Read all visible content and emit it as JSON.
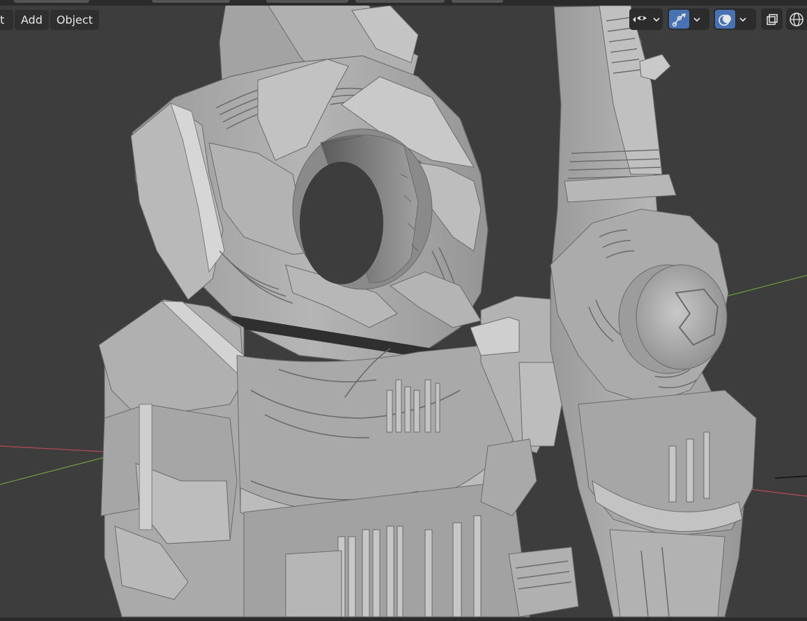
{
  "menu": {
    "items": [
      {
        "label": "t",
        "name": "menu-object-mode-cut"
      },
      {
        "label": "Add",
        "name": "menu-add"
      },
      {
        "label": "Object",
        "name": "menu-object"
      }
    ]
  },
  "toolbar": {
    "icons": [
      {
        "name": "visibility-eye-icon"
      },
      {
        "name": "gizmo-icon"
      },
      {
        "name": "overlays-icon"
      },
      {
        "name": "xray-toggle-icon"
      },
      {
        "name": "wireframe-shading-icon"
      }
    ]
  },
  "colors": {
    "viewport_bg": "#3d3d3d",
    "model_gray": "#a8a8a8",
    "model_light": "#c9c9c9",
    "model_dark": "#6d6d6d",
    "axis_x": "#b84b54",
    "axis_y": "#6e9a3a",
    "active_button": "#4772b3",
    "menu_bg": "#2f2f2f",
    "menu_text": "#e6e6e6"
  }
}
